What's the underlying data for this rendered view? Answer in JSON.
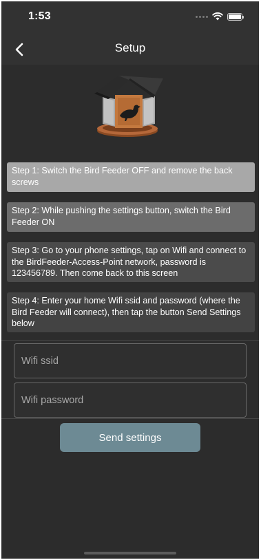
{
  "status_bar": {
    "time": "1:53",
    "icons": [
      "cellular-dots-icon",
      "wifi-icon",
      "battery-icon"
    ]
  },
  "nav": {
    "title": "Setup",
    "back_icon": "chevron-left-icon"
  },
  "hero_icon": "bird-feeder-illustration",
  "steps": [
    {
      "text": "Step 1: Switch the Bird Feeder OFF and remove the back screws"
    },
    {
      "text": "Step 2: While pushing the settings button, switch the Bird Feeder ON"
    },
    {
      "text": "Step 3: Go to your phone settings, tap on Wifi and connect to the BirdFeeder-Access-Point network, password is 123456789. Then come back to this screen"
    },
    {
      "text": "Step 4: Enter your home Wifi ssid and password (where the Bird Feeder will connect), then tap the button Send Settings below"
    }
  ],
  "form": {
    "ssid_placeholder": "Wifi ssid",
    "ssid_value": "",
    "password_placeholder": "Wifi password",
    "password_value": "",
    "send_label": "Send settings"
  },
  "colors": {
    "background": "#2c2c2c",
    "step_1": "#a8a8a8",
    "step_2": "#6c6c6c",
    "step_3": "#4b4b4b",
    "step_4": "#434343",
    "send_button": "#6d8a94"
  }
}
